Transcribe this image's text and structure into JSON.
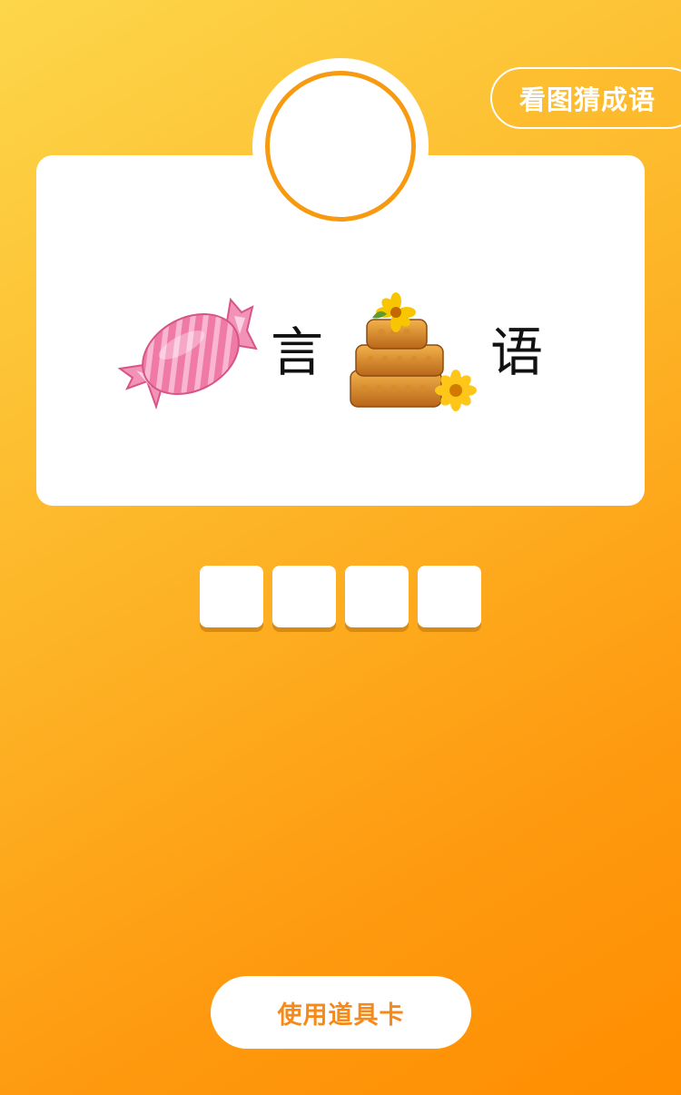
{
  "header": {
    "mode_label": "看图猜成语"
  },
  "puzzle": {
    "clue_1_icon": "candy-icon",
    "char_2": "言",
    "clue_3_icon": "honeycomb-icon",
    "char_4": "语"
  },
  "answer": {
    "slots": [
      "",
      "",
      "",
      ""
    ]
  },
  "footer": {
    "use_prop_label": "使用道具卡"
  },
  "colors": {
    "accent": "#f79a10",
    "button_text": "#f5891a"
  }
}
